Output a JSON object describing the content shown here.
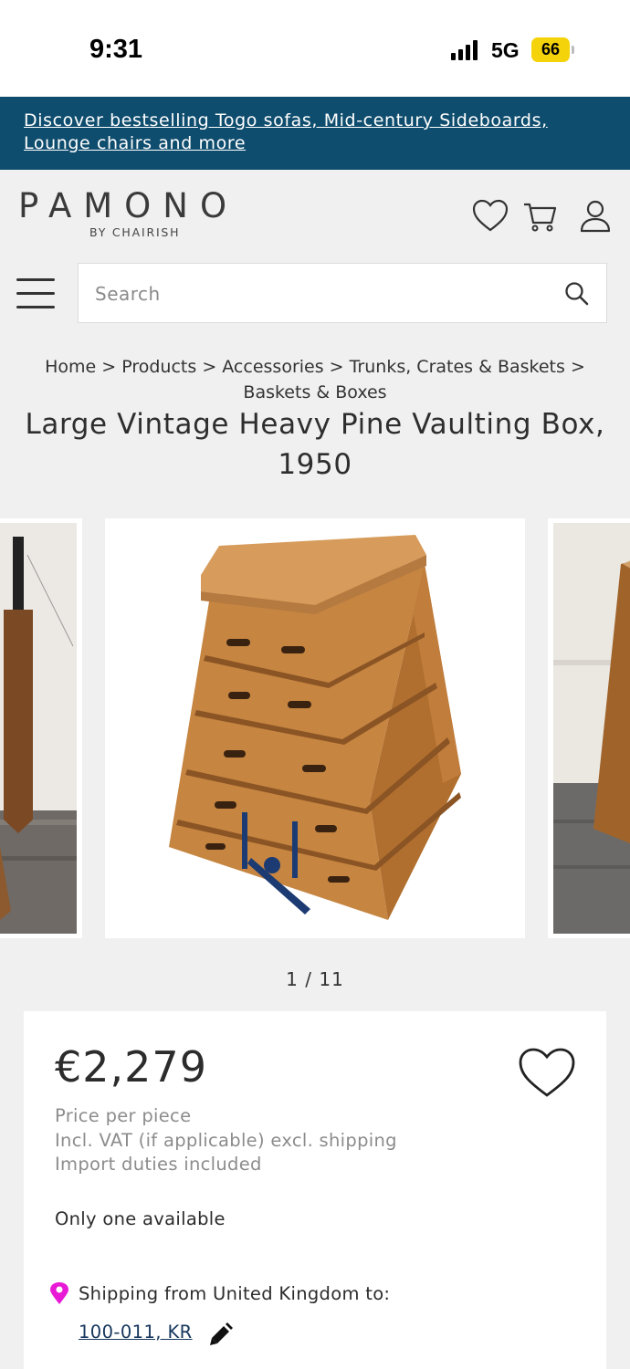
{
  "status_bar": {
    "time": "9:31",
    "network": "5G",
    "battery": "66"
  },
  "promo": {
    "text_line1": "Discover bestselling Togo sofas, Mid-century Sideboards,",
    "text_line2": "Lounge chairs and more"
  },
  "header": {
    "logo": "PAMONO",
    "logo_sub": "BY CHAIRISH",
    "icons": [
      "heart-icon",
      "cart-icon",
      "user-icon"
    ]
  },
  "search": {
    "placeholder": "Search"
  },
  "breadcrumb": {
    "line1": "Home > Products > Accessories > Trunks, Crates & Baskets >",
    "line2": "Baskets & Boxes"
  },
  "product": {
    "title_line1": "Large Vintage Heavy Pine Vaulting Box,",
    "title_line2": "1950",
    "image_counter": "1 / 11",
    "price": "€2,279",
    "price_note": "Price per piece",
    "vat_note": "Incl. VAT (if applicable) excl. shipping",
    "duties_note": "Import duties included",
    "availability": "Only one available",
    "shipping_label": "Shipping from United Kingdom to:",
    "postal_code": "100-011, KR"
  },
  "colors": {
    "banner": "#0f4d6e",
    "background": "#f0f0f0",
    "pin": "#e81ad6",
    "battery": "#f5d30a"
  }
}
